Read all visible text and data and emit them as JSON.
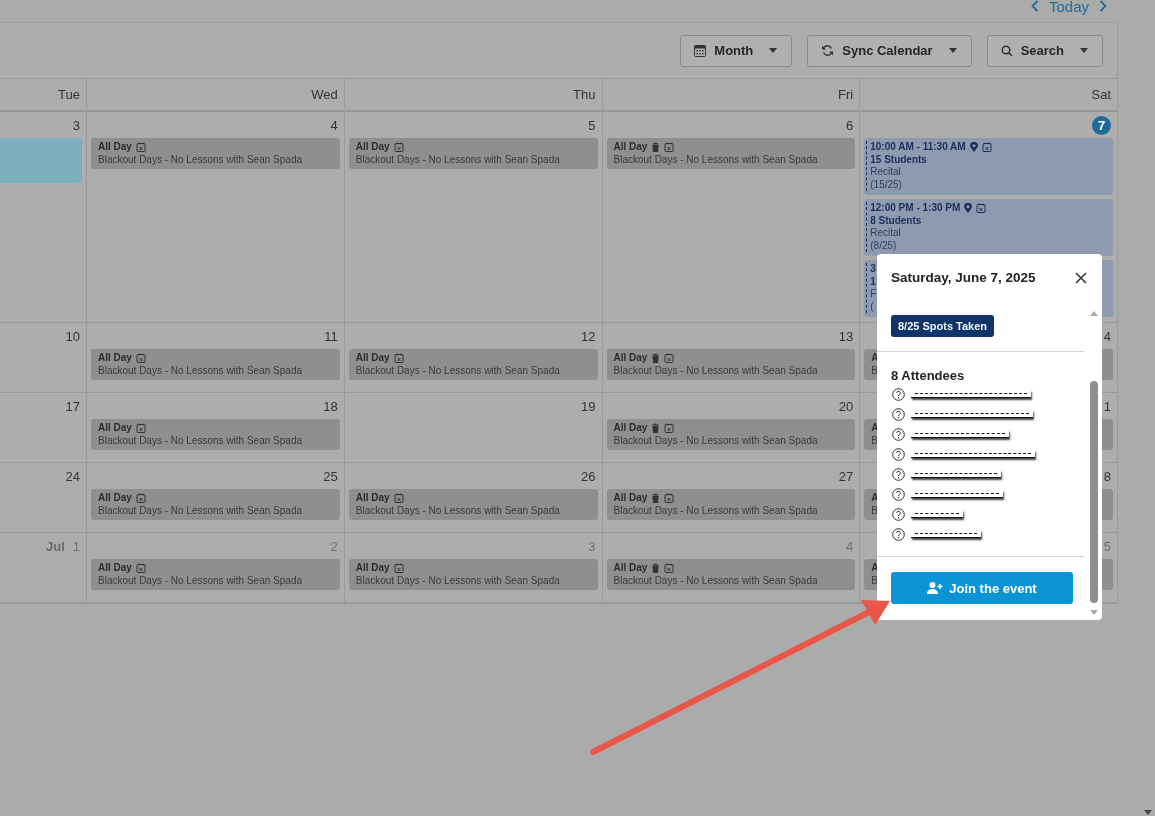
{
  "nav": {
    "today": "Today"
  },
  "toolbar": [
    {
      "label": "Month"
    },
    {
      "label": "Sync Calendar"
    },
    {
      "label": "Search"
    }
  ],
  "weekdays": [
    "Tue",
    "Wed",
    "Thu",
    "Fri",
    "Sat"
  ],
  "weeks": [
    {
      "days": [
        {
          "number": "3",
          "today": false,
          "muted": false,
          "events": [
            {
              "kind": "bar"
            }
          ]
        },
        {
          "number": "4",
          "today": false,
          "muted": false,
          "events": [
            {
              "kind": "blackout",
              "time": "All Day",
              "trash": false,
              "title": "Blackout Days - No Lessons with Sean Spada"
            }
          ]
        },
        {
          "number": "5",
          "today": false,
          "muted": false,
          "events": [
            {
              "kind": "blackout",
              "time": "All Day",
              "trash": false,
              "title": "Blackout Days - No Lessons with Sean Spada"
            }
          ]
        },
        {
          "number": "6",
          "today": false,
          "muted": false,
          "events": [
            {
              "kind": "blackout",
              "time": "All Day",
              "trash": true,
              "title": "Blackout Days - No Lessons with Sean Spada"
            }
          ]
        },
        {
          "number": "7",
          "today": true,
          "muted": false,
          "events": [
            {
              "kind": "session",
              "time": "10:00 AM - 11:30 AM",
              "title": "15 Students",
              "type": "Recital",
              "count": "(15/25)"
            },
            {
              "kind": "session",
              "time": "12:00 PM - 1:30 PM",
              "title": "8 Students",
              "type": "Recital",
              "count": "(8/25)"
            },
            {
              "kind": "session_clipped",
              "time": "3",
              "title": "1",
              "type": "F",
              "count": "("
            }
          ]
        }
      ]
    },
    {
      "days": [
        {
          "number": "10",
          "today": false,
          "muted": false
        },
        {
          "number": "11",
          "today": false,
          "muted": false,
          "events": [
            {
              "kind": "blackout",
              "time": "All Day",
              "trash": false,
              "title": "Blackout Days - No Lessons with Sean Spada"
            }
          ]
        },
        {
          "number": "12",
          "today": false,
          "muted": false,
          "events": [
            {
              "kind": "blackout",
              "time": "All Day",
              "trash": false,
              "title": "Blackout Days - No Lessons with Sean Spada"
            }
          ]
        },
        {
          "number": "13",
          "today": false,
          "muted": false,
          "events": [
            {
              "kind": "blackout",
              "time": "All Day",
              "trash": true,
              "title": "Blackout Days - No Lessons with Sean Spada"
            }
          ]
        },
        {
          "number": "4",
          "today": false,
          "muted": false,
          "events": [
            {
              "kind": "blackout_clipped",
              "time": "A",
              "title": "B"
            }
          ]
        }
      ]
    },
    {
      "days": [
        {
          "number": "17",
          "today": false,
          "muted": false
        },
        {
          "number": "18",
          "today": false,
          "muted": false,
          "events": [
            {
              "kind": "blackout",
              "time": "All Day",
              "trash": false,
              "title": "Blackout Days - No Lessons with Sean Spada"
            }
          ]
        },
        {
          "number": "19",
          "today": false,
          "muted": false
        },
        {
          "number": "20",
          "today": false,
          "muted": false,
          "events": [
            {
              "kind": "blackout",
              "time": "All Day",
              "trash": true,
              "title": "Blackout Days - No Lessons with Sean Spada"
            }
          ]
        },
        {
          "number": "1",
          "today": false,
          "muted": false,
          "events": [
            {
              "kind": "blackout_clipped",
              "time": "A",
              "title": "B"
            }
          ]
        }
      ]
    },
    {
      "days": [
        {
          "number": "24",
          "today": false,
          "muted": false
        },
        {
          "number": "25",
          "today": false,
          "muted": false,
          "events": [
            {
              "kind": "blackout",
              "time": "All Day",
              "trash": false,
              "title": "Blackout Days - No Lessons with Sean Spada"
            }
          ]
        },
        {
          "number": "26",
          "today": false,
          "muted": false,
          "events": [
            {
              "kind": "blackout",
              "time": "All Day",
              "trash": false,
              "title": "Blackout Days - No Lessons with Sean Spada"
            }
          ]
        },
        {
          "number": "27",
          "today": false,
          "muted": false,
          "events": [
            {
              "kind": "blackout",
              "time": "All Day",
              "trash": true,
              "title": "Blackout Days - No Lessons with Sean Spada"
            }
          ]
        },
        {
          "number": "8",
          "today": false,
          "muted": false,
          "events": [
            {
              "kind": "blackout_clipped",
              "time": "A",
              "title": "B"
            }
          ]
        }
      ]
    },
    {
      "days": [
        {
          "month": "Jul",
          "number": "1",
          "today": false,
          "muted": true
        },
        {
          "number": "2",
          "today": false,
          "muted": true,
          "events": [
            {
              "kind": "blackout",
              "time": "All Day",
              "trash": false,
              "title": "Blackout Days - No Lessons with Sean Spada"
            }
          ]
        },
        {
          "number": "3",
          "today": false,
          "muted": true,
          "events": [
            {
              "kind": "blackout",
              "time": "All Day",
              "trash": false,
              "title": "Blackout Days - No Lessons with Sean Spada"
            }
          ]
        },
        {
          "number": "4",
          "today": false,
          "muted": true,
          "events": [
            {
              "kind": "blackout",
              "time": "All Day",
              "trash": true,
              "title": "Blackout Days - No Lessons with Sean Spada"
            }
          ]
        },
        {
          "number": "5",
          "today": false,
          "muted": true,
          "events": [
            {
              "kind": "blackout_clipped",
              "time": "A",
              "title": "B"
            }
          ]
        }
      ]
    }
  ],
  "popup": {
    "title": "Saturday, June 7, 2025",
    "badge": "8/25 Spots Taken",
    "attendees_heading": "8 Attendees",
    "attendees": [
      {
        "kind": "redacted"
      },
      {
        "kind": "redacted"
      },
      {
        "kind": "redacted"
      },
      {
        "kind": "redacted"
      },
      {
        "kind": "redacted"
      },
      {
        "kind": "redacted"
      },
      {
        "kind": "redacted"
      },
      {
        "kind": "redacted"
      }
    ],
    "button": "Join the event"
  }
}
